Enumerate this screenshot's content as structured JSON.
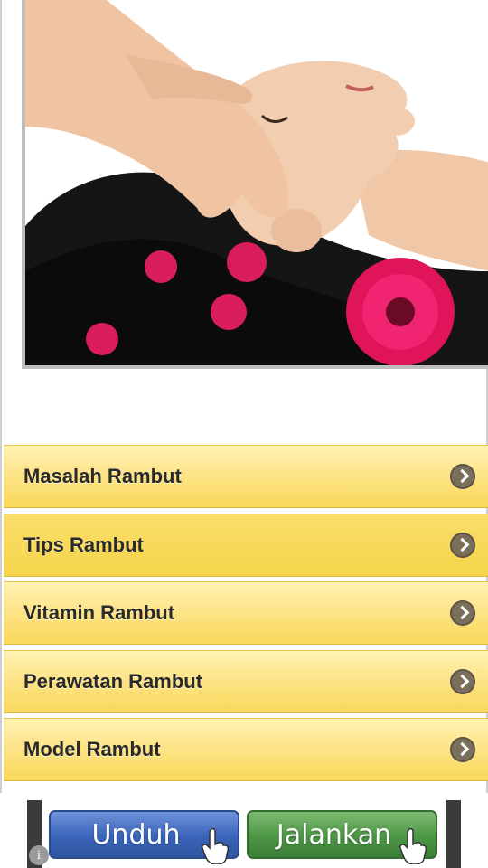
{
  "hero": {
    "image": "spa-massage-woman-with-flowers-photo"
  },
  "menu": {
    "items": [
      {
        "label": "Masalah Rambut",
        "icon": "chevron-right-icon"
      },
      {
        "label": "Tips Rambut",
        "icon": "chevron-right-icon"
      },
      {
        "label": "Vitamin Rambut",
        "icon": "chevron-right-icon"
      },
      {
        "label": "Perawatan Rambut",
        "icon": "chevron-right-icon"
      },
      {
        "label": "Model Rambut",
        "icon": "chevron-right-icon"
      }
    ],
    "active_index": 1
  },
  "ad": {
    "info_icon": "info-icon",
    "download_label": "Unduh",
    "run_label": "Jalankan",
    "pointer_icon": "hand-pointer-icon"
  },
  "colors": {
    "menu_gradient_top": "#fff3b3",
    "menu_gradient_bottom": "#f8d95a",
    "menu_active": "#f5d54a",
    "chevron": "#7a6f5b",
    "download_button": "#3a64b9",
    "run_button": "#4c9645"
  }
}
